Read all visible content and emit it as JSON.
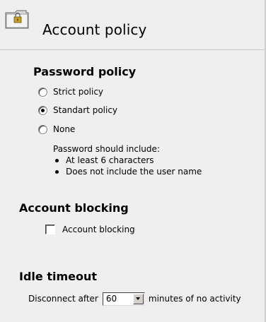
{
  "header": {
    "title": "Account policy",
    "icon": "lock-folder-icon"
  },
  "password_policy": {
    "title": "Password policy",
    "options": [
      {
        "label": "Strict policy",
        "checked": false
      },
      {
        "label": "Standart policy",
        "checked": true
      },
      {
        "label": "None",
        "checked": false
      }
    ],
    "info_intro": "Password should include:",
    "info_items": [
      "At least 6 characters",
      "Does not include the user name"
    ]
  },
  "account_blocking": {
    "title": "Account blocking",
    "checkbox_label": "Account blocking",
    "checked": false
  },
  "idle_timeout": {
    "title": "Idle timeout",
    "prefix": "Disconnect after",
    "value": "60",
    "suffix": "minutes of no activity"
  }
}
